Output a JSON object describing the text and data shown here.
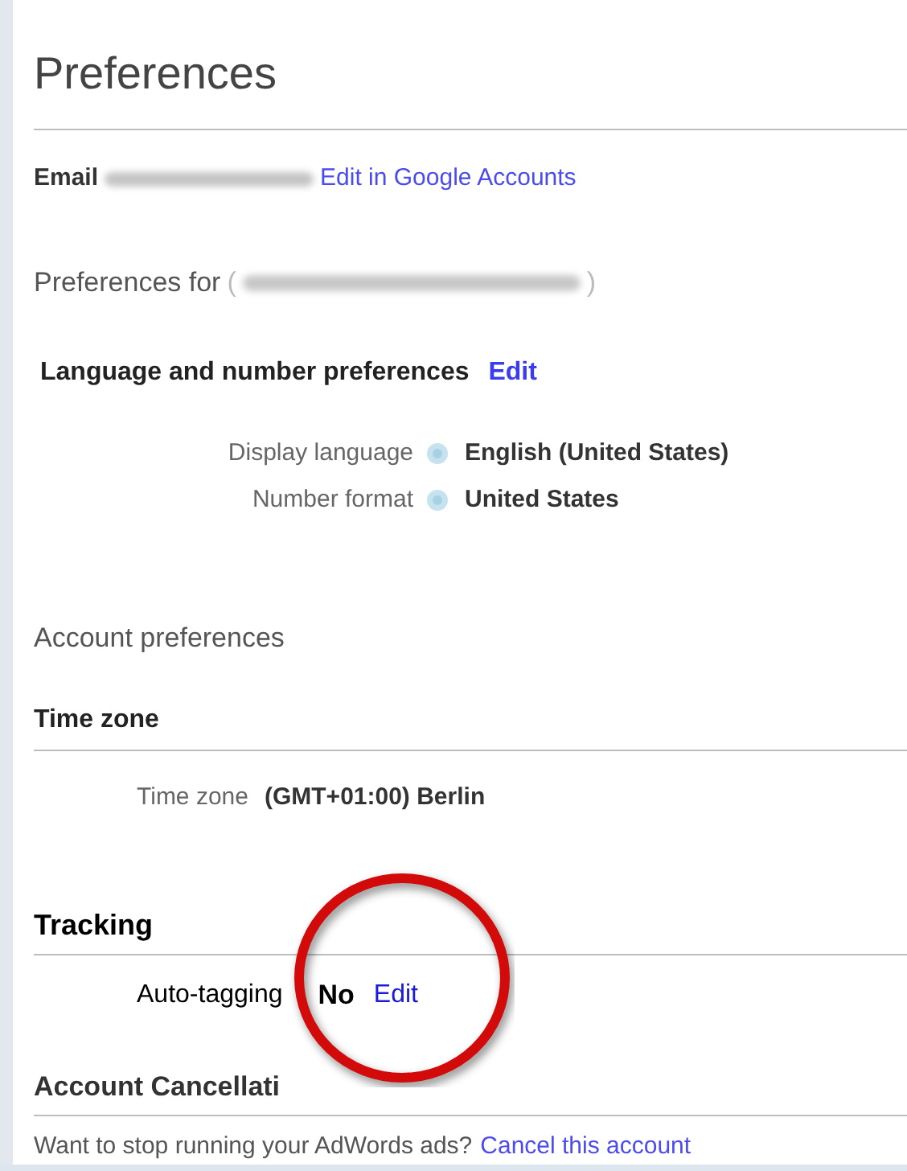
{
  "title": "Preferences",
  "email": {
    "label": "Email",
    "link": "Edit in Google Accounts"
  },
  "preferences_for": {
    "label": "Preferences for",
    "open": "(",
    "close": ")"
  },
  "language_section": {
    "heading": "Language and number preferences",
    "link": "Edit",
    "rows": [
      {
        "label": "Display language",
        "value": "English (United States)"
      },
      {
        "label": "Number format",
        "value": "United States"
      }
    ]
  },
  "account_preferences": "Account preferences",
  "time_zone_section": {
    "heading": "Time zone",
    "label": "Time zone",
    "value": "(GMT+01:00) Berlin"
  },
  "tracking_section": {
    "heading": "Tracking",
    "label": "Auto-tagging",
    "value": "No",
    "link": "Edit"
  },
  "cancellation_section": {
    "heading": "Account Cancellati",
    "text": "Want to stop running your AdWords ads?",
    "link": "Cancel this account"
  }
}
